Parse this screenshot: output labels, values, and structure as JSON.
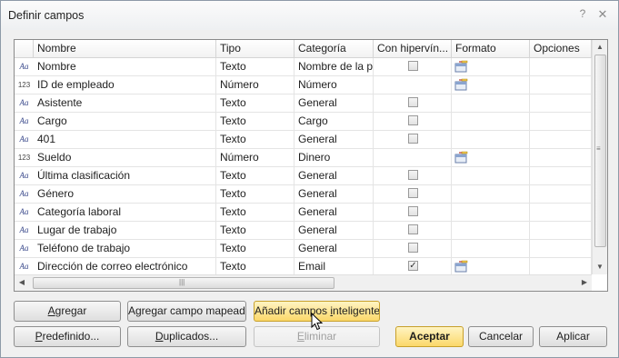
{
  "window": {
    "title": "Definir campos",
    "help_glyph": "?",
    "close_glyph": "✕"
  },
  "grid": {
    "columns": [
      "Nombre",
      "Tipo",
      "Categoría",
      "Con hipervín...",
      "Formato",
      "Opciones"
    ],
    "rows": [
      {
        "icon": "text-type-icon",
        "icon_text": "Aa",
        "name": "Nombre",
        "tipo": "Texto",
        "categoria": "Nombre de la p",
        "hyperlink": "unchecked",
        "formato": true
      },
      {
        "icon": "number-type-icon",
        "icon_text": "123",
        "name": "ID de empleado",
        "tipo": "Número",
        "categoria": "Número",
        "hyperlink": "none",
        "formato": true
      },
      {
        "icon": "text-type-icon",
        "icon_text": "Aa",
        "name": "Asistente",
        "tipo": "Texto",
        "categoria": "General",
        "hyperlink": "unchecked",
        "formato": false
      },
      {
        "icon": "text-type-icon",
        "icon_text": "Aa",
        "name": "Cargo",
        "tipo": "Texto",
        "categoria": "Cargo",
        "hyperlink": "unchecked",
        "formato": false
      },
      {
        "icon": "text-type-icon",
        "icon_text": "Aa",
        "name": "401",
        "tipo": "Texto",
        "categoria": "General",
        "hyperlink": "unchecked",
        "formato": false
      },
      {
        "icon": "number-type-icon",
        "icon_text": "123",
        "name": "Sueldo",
        "tipo": "Número",
        "categoria": "Dinero",
        "hyperlink": "none",
        "formato": true
      },
      {
        "icon": "text-type-icon",
        "icon_text": "Aa",
        "name": "Última clasificación",
        "tipo": "Texto",
        "categoria": "General",
        "hyperlink": "unchecked",
        "formato": false
      },
      {
        "icon": "text-type-icon",
        "icon_text": "Aa",
        "name": "Género",
        "tipo": "Texto",
        "categoria": "General",
        "hyperlink": "unchecked",
        "formato": false
      },
      {
        "icon": "text-type-icon",
        "icon_text": "Aa",
        "name": "Categoría laboral",
        "tipo": "Texto",
        "categoria": "General",
        "hyperlink": "unchecked",
        "formato": false
      },
      {
        "icon": "text-type-icon",
        "icon_text": "Aa",
        "name": "Lugar de trabajo",
        "tipo": "Texto",
        "categoria": "General",
        "hyperlink": "unchecked",
        "formato": false
      },
      {
        "icon": "text-type-icon",
        "icon_text": "Aa",
        "name": "Teléfono de trabajo",
        "tipo": "Texto",
        "categoria": "General",
        "hyperlink": "unchecked",
        "formato": false
      },
      {
        "icon": "text-type-icon",
        "icon_text": "Aa",
        "name": "Dirección de correo electrónico",
        "tipo": "Texto",
        "categoria": "Email",
        "hyperlink": "checked",
        "formato": true
      }
    ]
  },
  "buttons": {
    "agregar": {
      "pre": "",
      "u": "A",
      "post": "gregar"
    },
    "agregar_mapeado": {
      "pre": "Agregar campo mapeado",
      "u": "",
      "post": ""
    },
    "anadir_inteligentes": {
      "pre": "Añadir campos ",
      "u": "i",
      "post": "nteligentes"
    },
    "predefinido": {
      "pre": "",
      "u": "P",
      "post": "redefinido..."
    },
    "duplicados": {
      "pre": "",
      "u": "D",
      "post": "uplicados..."
    },
    "eliminar": {
      "pre": "",
      "u": "E",
      "post": "liminar"
    },
    "aceptar": {
      "pre": "Aceptar",
      "u": "",
      "post": ""
    },
    "cancelar": {
      "pre": "Cancelar",
      "u": "",
      "post": ""
    },
    "aplicar": {
      "pre": "Aplicar",
      "u": "",
      "post": ""
    }
  },
  "colors": {
    "accent_yellow": "#fbd86a",
    "dialog_bg": "#f0f0f0",
    "border": "#8b8b8b"
  }
}
